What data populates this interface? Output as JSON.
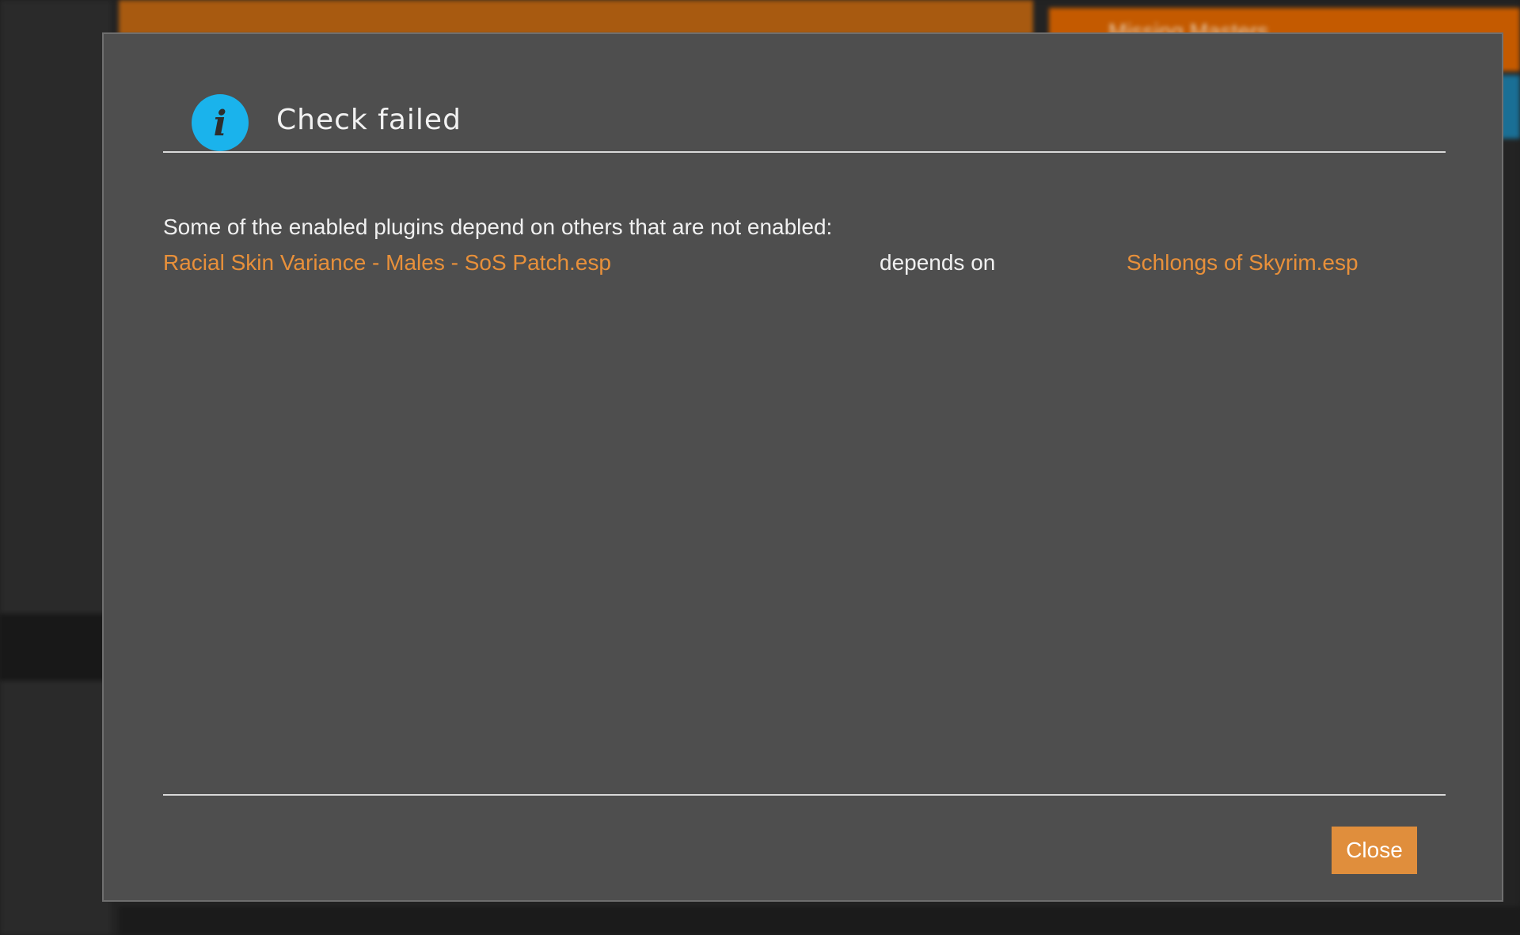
{
  "background": {
    "notification_title": "Missing Masters"
  },
  "dialog": {
    "icon": "info-icon",
    "icon_glyph": "i",
    "title": "Check failed",
    "message": "Some of the enabled plugins depend on others that are not enabled:",
    "dependencies": [
      {
        "plugin": "Racial Skin Variance - Males - SoS Patch.esp",
        "relation": "depends on",
        "master": "Schlongs of Skyrim.esp"
      }
    ],
    "close_label": "Close"
  },
  "colors": {
    "accent": "#e08e3c",
    "link_orange": "#e8903a",
    "info_blue": "#1ab3ec",
    "modal_bg": "#4e4e4e"
  }
}
